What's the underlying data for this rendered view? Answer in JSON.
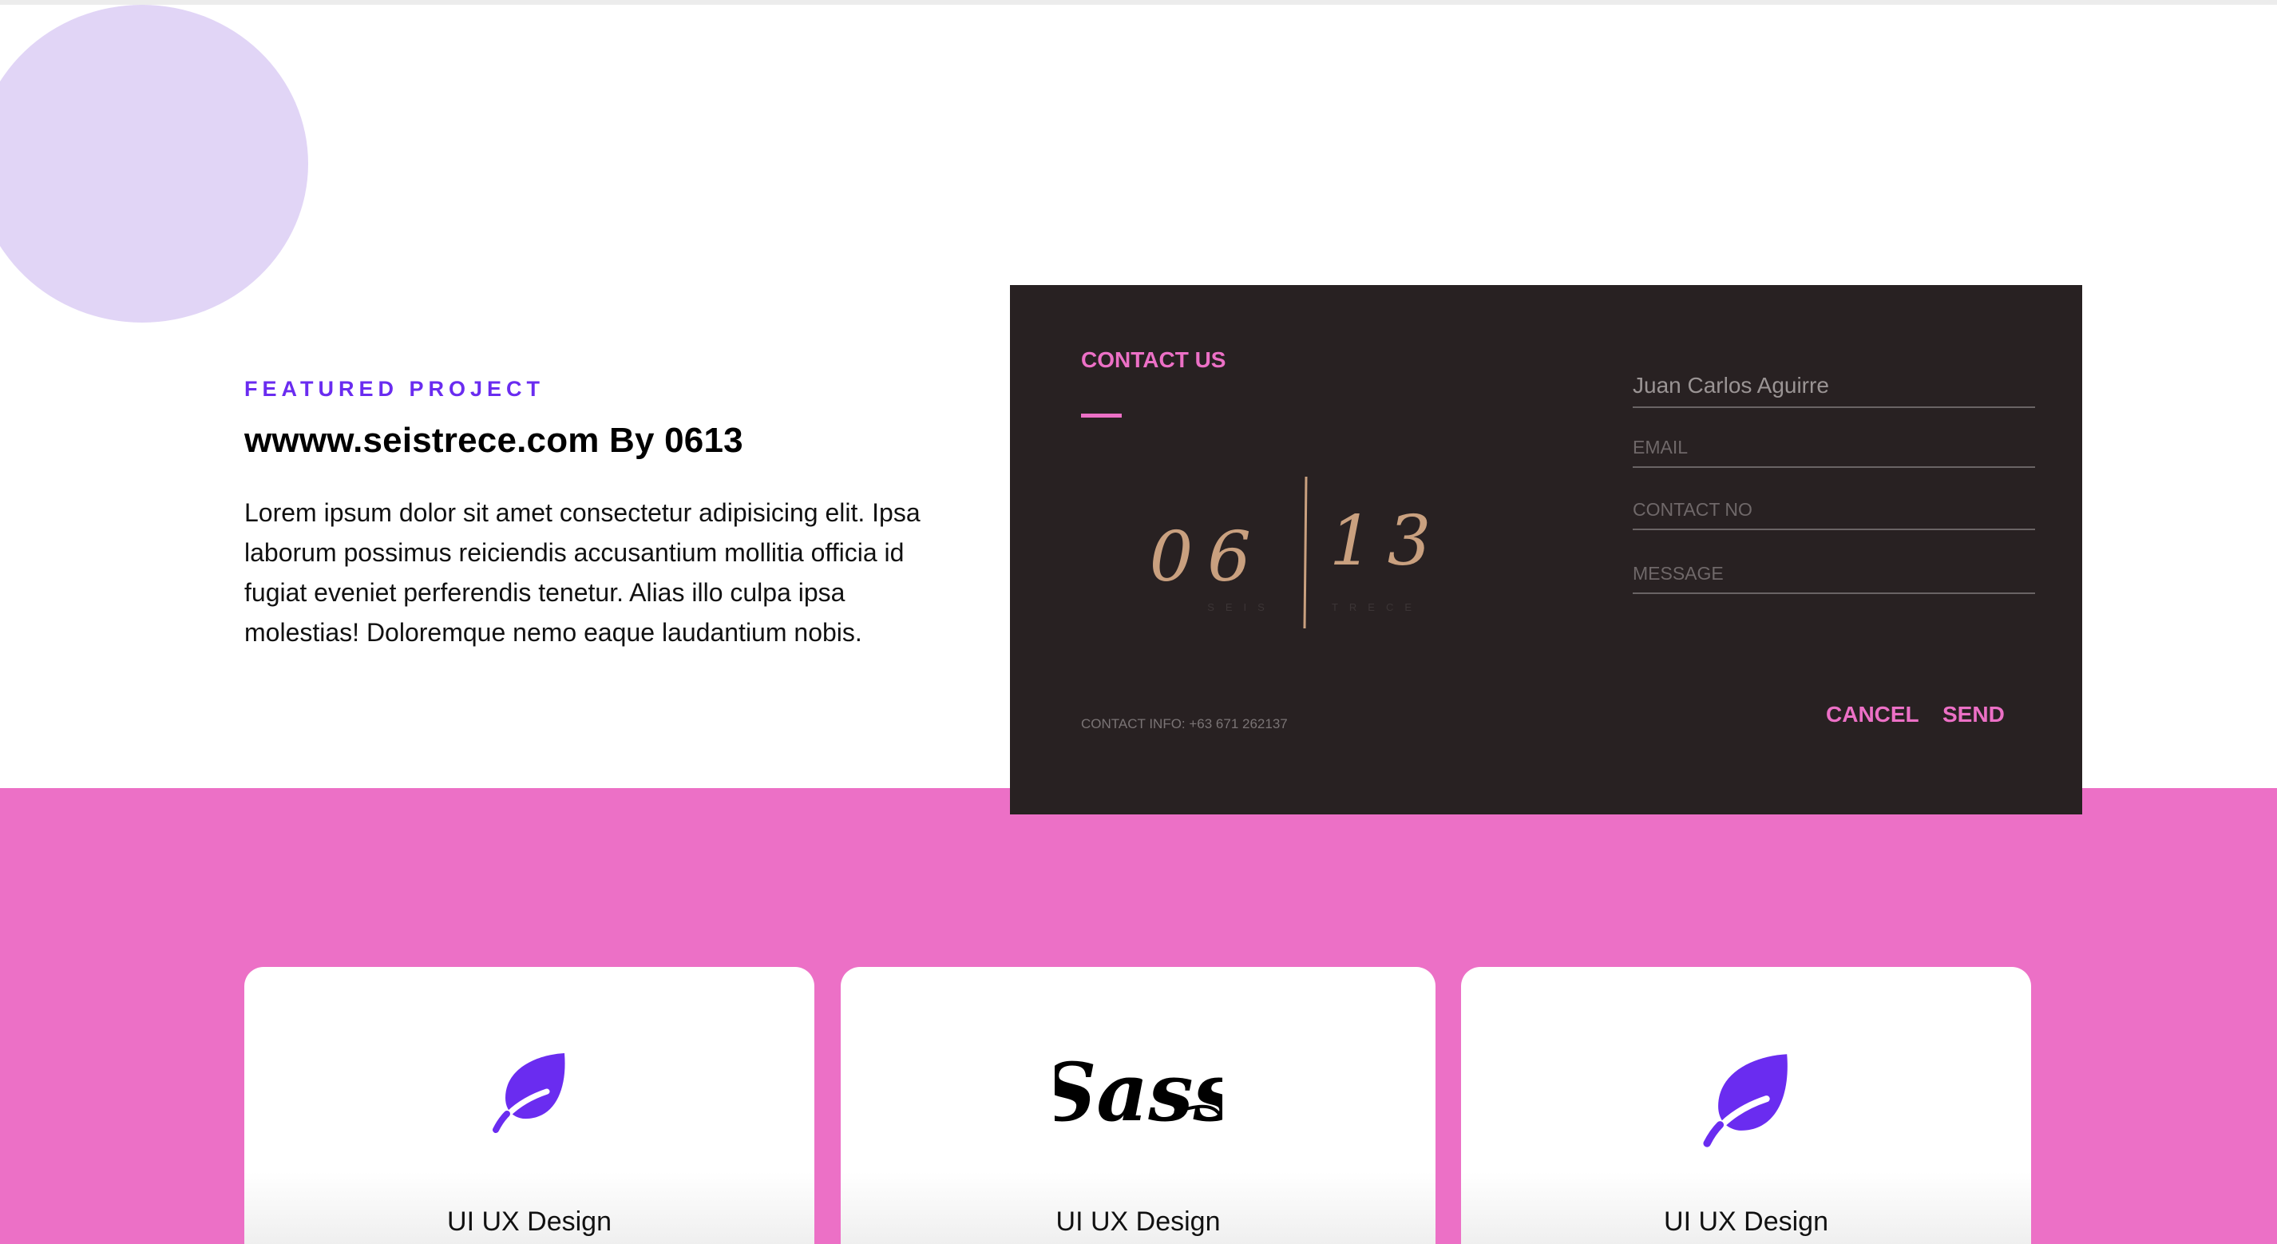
{
  "featured": {
    "eyebrow": "FEATURED PROJECT",
    "title": "wwww.seistrece.com By 0613",
    "description": "Lorem ipsum dolor sit amet consectetur adipisicing elit. Ipsa laborum possimus reiciendis accusantium mollitia officia id fugiat eveniet perferendis tenetur. Alias illo culpa ipsa molestias! Doloremque nemo eaque laudantium nobis."
  },
  "contact_card": {
    "title": "CONTACT US",
    "logo": {
      "left_digits": "06",
      "right_digits": "13",
      "left_word": "SEIS",
      "right_word": "TRECE"
    },
    "name_value": "Juan Carlos Aguirre",
    "email_placeholder": "EMAIL",
    "contact_placeholder": "CONTACT NO",
    "message_placeholder": "MESSAGE",
    "info": "CONTACT INFO: +63 671 262137",
    "cancel_label": "CANCEL",
    "send_label": "SEND"
  },
  "services": [
    {
      "icon": "leaf-icon",
      "label": "UI UX Design"
    },
    {
      "icon": "sass-logo",
      "label": "UI UX Design",
      "logo_text": "Sass"
    },
    {
      "icon": "leaf-icon",
      "label": "UI UX Design"
    }
  ],
  "colors": {
    "accent_purple": "#6a2cf0",
    "accent_pink": "#ec70c6",
    "card_dark": "#282122",
    "circle_lavender": "#e1d5f6",
    "logo_gold": "#c9a07f"
  }
}
